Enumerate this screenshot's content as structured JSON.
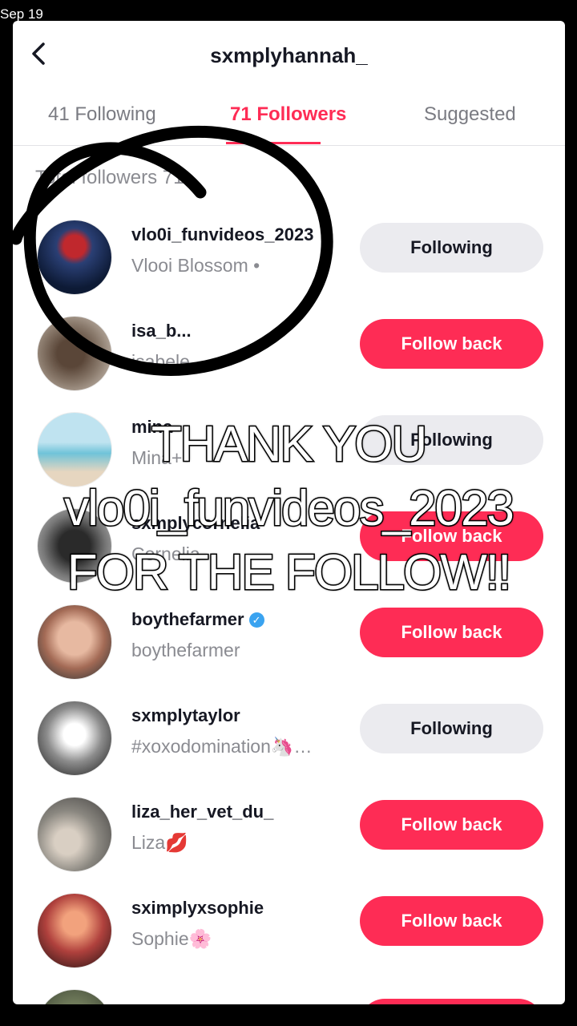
{
  "status": {
    "date": "Sep 19"
  },
  "header": {
    "title": "sxmplyhannah_"
  },
  "tabs": [
    {
      "label": "41 Following",
      "active": false
    },
    {
      "label": "71 Followers",
      "active": true
    },
    {
      "label": "Suggested",
      "active": false
    }
  ],
  "total_label": "Total followers 71",
  "followers": [
    {
      "username": "vlo0i_funvideos_2023",
      "subname": "Vlooi Blossom •",
      "button": "Following",
      "verified": false
    },
    {
      "username": "isa_b...",
      "subname": "isabele",
      "button": "Follow back",
      "verified": false
    },
    {
      "username": "mina",
      "subname": "Mina+",
      "button": "Following",
      "verified": false
    },
    {
      "username": "sxmplycornelia",
      "subname": "Cornelia",
      "button": "Follow back",
      "verified": false
    },
    {
      "username": "boythefarmer",
      "subname": "boythefarmer",
      "button": "Follow back",
      "verified": true
    },
    {
      "username": "sxmplytaylor",
      "subname": "#xoxodomination🦄…",
      "button": "Following",
      "verified": false
    },
    {
      "username": "liza_her_vet_du_",
      "subname": "Liza💋",
      "button": "Follow back",
      "verified": false
    },
    {
      "username": "sximplyxsophie",
      "subname": "Sophie🌸",
      "button": "Follow back",
      "verified": false
    }
  ],
  "overlay": {
    "line1": "THANK YOU",
    "line2": "vlo0i_funvideos_2023",
    "line3": "FOR THE FOLLOW!!"
  },
  "colors": {
    "accent": "#fe2c55",
    "following_bg": "#ebebef"
  },
  "icons": {
    "back": "chevron-left-icon",
    "verified": "verified-badge-icon"
  }
}
